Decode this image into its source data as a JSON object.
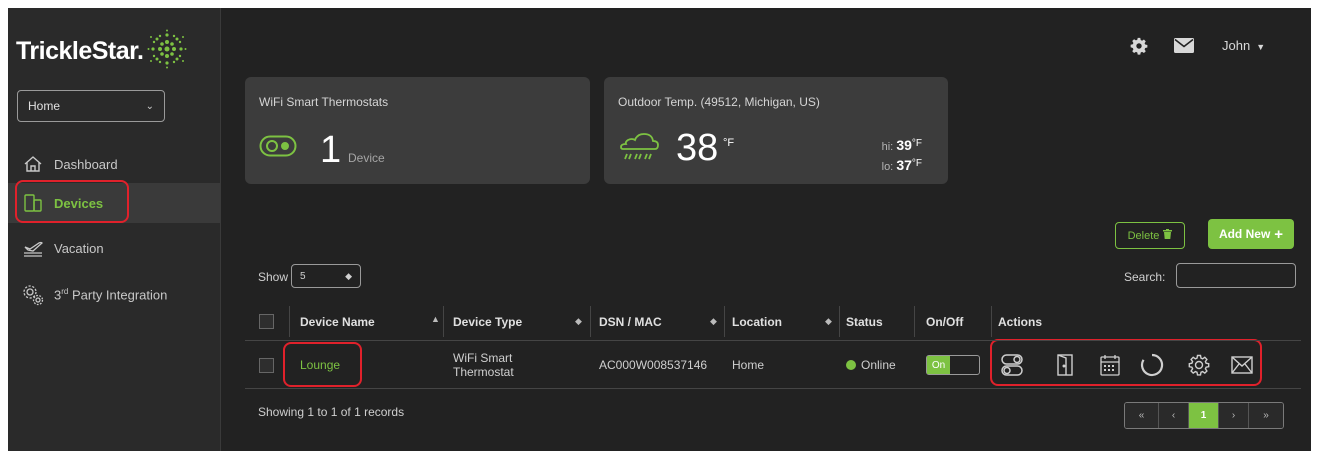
{
  "brand": {
    "name": "TrickleStar.",
    "accent": "#7dc242"
  },
  "sidebar": {
    "home_select": "Home",
    "items": [
      {
        "label": "Dashboard",
        "icon": "home-icon",
        "active": false
      },
      {
        "label": "Devices",
        "icon": "devices-icon",
        "active": true
      },
      {
        "label": "Vacation",
        "icon": "plane-icon",
        "active": false
      },
      {
        "label_pre": "3",
        "label_sup": "rd",
        "label_post": " Party Integration",
        "icon": "gears-icon",
        "active": false
      }
    ]
  },
  "header": {
    "user": "John"
  },
  "cards": {
    "thermostats": {
      "title": "WiFi Smart Thermostats",
      "count": "1",
      "unit": "Device"
    },
    "outdoor": {
      "title": "Outdoor Temp. (49512, Michigan, US)",
      "temp": "38",
      "temp_unit": "°F",
      "hi_label": "hi:",
      "hi": "39",
      "lo_label": "lo:",
      "lo": "37",
      "unit": "°F"
    }
  },
  "buttons": {
    "delete": "Delete",
    "add_new": "Add New"
  },
  "table_controls": {
    "show_label": "Show",
    "show_value": "5",
    "search_label": "Search:"
  },
  "table": {
    "headers": [
      "Device Name",
      "Device Type",
      "DSN / MAC",
      "Location",
      "Status",
      "On/Off",
      "Actions"
    ],
    "rows": [
      {
        "name": "Lounge",
        "type_line1": "WiFi Smart",
        "type_line2": "Thermostat",
        "dsn": "AC000W008537146",
        "location": "Home",
        "status": "Online",
        "onoff": "On"
      }
    ]
  },
  "footer": {
    "records": "Showing 1 to 1 of 1 records"
  },
  "pager": {
    "first": "«",
    "prev": "‹",
    "current": "1",
    "next": "›",
    "last": "»"
  }
}
